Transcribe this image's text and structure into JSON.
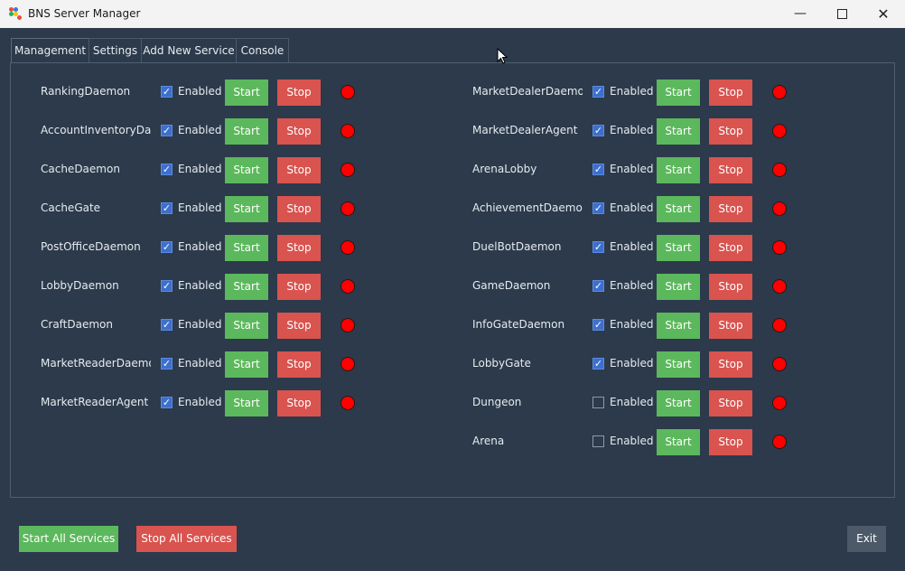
{
  "window": {
    "title": "BNS Server Manager",
    "minimize_glyph": "—",
    "close_glyph": "✕"
  },
  "tabs": [
    {
      "label": "Management",
      "active": true
    },
    {
      "label": "Settings",
      "active": false
    },
    {
      "label": "Add New Service",
      "active": false
    },
    {
      "label": "Console",
      "active": false
    }
  ],
  "services": {
    "enabled_label": "Enabled",
    "start_label": "Start",
    "stop_label": "Stop",
    "check_glyph": "✓",
    "left": [
      {
        "name": "RankingDaemon",
        "enabled": true
      },
      {
        "name": "AccountInventoryDaer",
        "enabled": true
      },
      {
        "name": "CacheDaemon",
        "enabled": true
      },
      {
        "name": "CacheGate",
        "enabled": true
      },
      {
        "name": "PostOfficeDaemon",
        "enabled": true
      },
      {
        "name": "LobbyDaemon",
        "enabled": true
      },
      {
        "name": "CraftDaemon",
        "enabled": true
      },
      {
        "name": "MarketReaderDaemon",
        "enabled": true
      },
      {
        "name": "MarketReaderAgent",
        "enabled": true
      }
    ],
    "right": [
      {
        "name": "MarketDealerDaemon",
        "enabled": true
      },
      {
        "name": "MarketDealerAgent",
        "enabled": true
      },
      {
        "name": "ArenaLobby",
        "enabled": true
      },
      {
        "name": "AchievementDaemon",
        "enabled": true
      },
      {
        "name": "DuelBotDaemon",
        "enabled": true
      },
      {
        "name": "GameDaemon",
        "enabled": true
      },
      {
        "name": "InfoGateDaemon",
        "enabled": true
      },
      {
        "name": "LobbyGate",
        "enabled": true
      },
      {
        "name": "Dungeon",
        "enabled": false
      },
      {
        "name": "Arena",
        "enabled": false
      }
    ]
  },
  "footer": {
    "start_all_label": "Start All Services",
    "stop_all_label": "Stop All Services",
    "exit_label": "Exit"
  },
  "colors": {
    "background": "#2c3a4b",
    "start": "#5cb85c",
    "stop": "#d9534f",
    "status_stopped": "#ff0000",
    "checkbox_on": "#3d6fcf"
  }
}
